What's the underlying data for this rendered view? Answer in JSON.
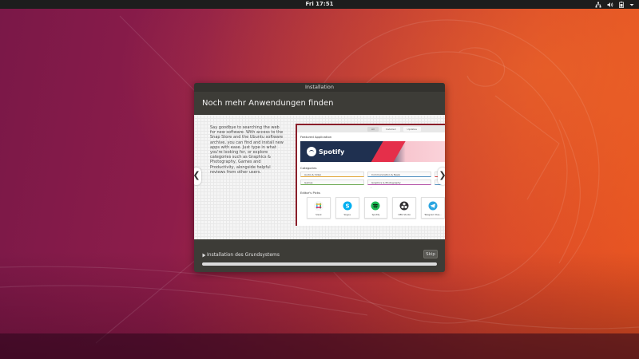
{
  "topbar": {
    "clock": "Fri 17:51"
  },
  "colors": {
    "bg_accent": "#e95420",
    "bg_aubergine": "#7a1848",
    "dialog_bg": "#3d3c37",
    "store_banner": "#1f3050",
    "spotify_green": "#1db954"
  },
  "dialog": {
    "title": "Installation",
    "headline": "Noch mehr Anwendungen finden",
    "slide_text": "Say goodbye to searching the web for new software. With access to the Snap Store and the Ubuntu software archive, you can find and install new apps with ease. Just type in what you're looking for, or explore categories such as Graphics & Photography, Games and Productivity, alongside helpful reviews from other users.",
    "nav_prev": "❮",
    "nav_next": "❯",
    "store": {
      "tabs": [
        "All",
        "Installed",
        "Updates"
      ],
      "featured_label": "Featured Application",
      "featured_app": "Spotify",
      "categories_label": "Categories",
      "categories": [
        "Audio & Video",
        "Communication & News",
        "Games",
        "Graphics & Photography"
      ],
      "more_toggle": "⌄",
      "editors_label": "Editor's Picks",
      "picks": [
        {
          "name": "Slack",
          "icon": "slack-icon",
          "color": "#ffffff"
        },
        {
          "name": "Skype",
          "icon": "skype-icon",
          "color": "#00aff0"
        },
        {
          "name": "Spotify",
          "icon": "spotify-icon",
          "color": "#1db954"
        },
        {
          "name": "OBS Studio",
          "icon": "obs-icon",
          "color": "#302e31"
        },
        {
          "name": "Telegram Des...",
          "icon": "telegram-icon",
          "color": "#2ca5e0"
        }
      ]
    },
    "status": "Installation des Grundsystems",
    "skip_label": "Skip",
    "progress": 1.0
  }
}
